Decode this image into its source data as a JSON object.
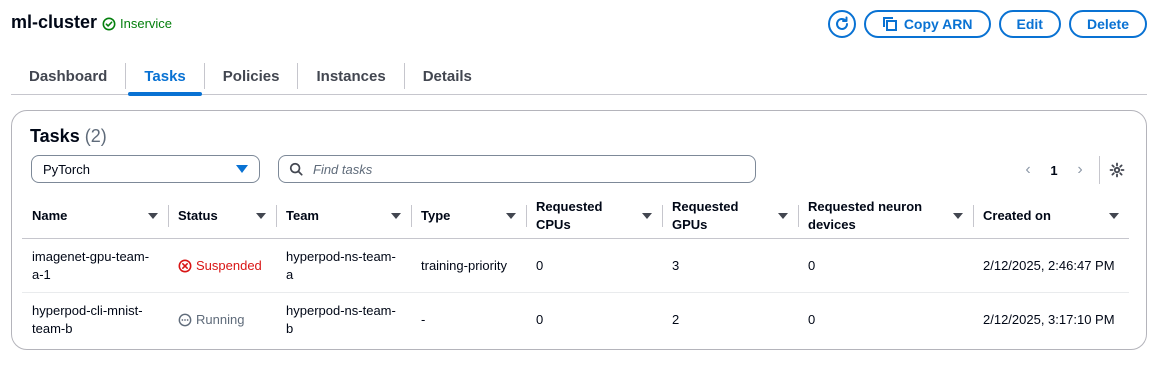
{
  "header": {
    "title": "ml-cluster",
    "status": "Inservice",
    "copy_arn_label": "Copy ARN",
    "edit_label": "Edit",
    "delete_label": "Delete"
  },
  "tabs": [
    {
      "label": "Dashboard",
      "active": false
    },
    {
      "label": "Tasks",
      "active": true
    },
    {
      "label": "Policies",
      "active": false
    },
    {
      "label": "Instances",
      "active": false
    },
    {
      "label": "Details",
      "active": false
    }
  ],
  "panel": {
    "title": "Tasks",
    "count": "(2)",
    "filter_value": "PyTorch",
    "search_placeholder": "Find tasks",
    "page": "1"
  },
  "table": {
    "columns": [
      "Name",
      "Status",
      "Team",
      "Type",
      "Requested CPUs",
      "Requested GPUs",
      "Requested neuron devices",
      "Created on"
    ],
    "rows": [
      {
        "name": "imagenet-gpu-team-a-1",
        "status": "Suspended",
        "status_kind": "error",
        "team": "hyperpod-ns-team-a",
        "type": "training-priority",
        "cpus": "0",
        "gpus": "3",
        "neuron": "0",
        "created": "2/12/2025, 2:46:47 PM"
      },
      {
        "name": "hyperpod-cli-mnist-team-b",
        "status": "Running",
        "status_kind": "running",
        "team": "hyperpod-ns-team-b",
        "type": "-",
        "cpus": "0",
        "gpus": "2",
        "neuron": "0",
        "created": "2/12/2025, 3:17:10 PM"
      }
    ]
  },
  "colors": {
    "accent": "#0972d3",
    "success": "#037f0c",
    "error": "#d91515",
    "muted": "#5f6b7a"
  },
  "icons": {
    "refresh": "refresh-icon",
    "copy": "copy-icon",
    "search": "search-icon",
    "settings": "gear-icon",
    "status_ok": "check-circle-icon",
    "status_error": "x-circle-icon",
    "status_running": "ellipsis-circle-icon"
  }
}
